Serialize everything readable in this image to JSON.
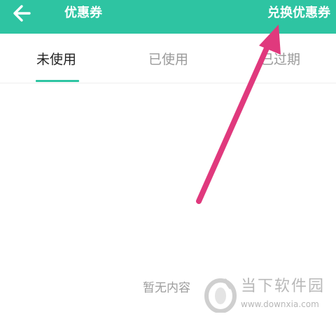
{
  "header": {
    "back_icon": "arrow-left-icon",
    "title": "优惠券",
    "exchange_label": "兑换优惠券",
    "background": "#2ec4a2"
  },
  "tabs": [
    {
      "label": "未使用",
      "active": true
    },
    {
      "label": "已使用",
      "active": false
    },
    {
      "label": "已过期",
      "active": false
    }
  ],
  "tab_indicator_color": "#2ec4a2",
  "main": {
    "empty_text": "暂无内容"
  },
  "annotation": {
    "arrow_icon": "pink-arrow-icon",
    "color": "#e0397d"
  },
  "watermark": {
    "name": "当下软件园",
    "url": "www.downxia.com"
  }
}
